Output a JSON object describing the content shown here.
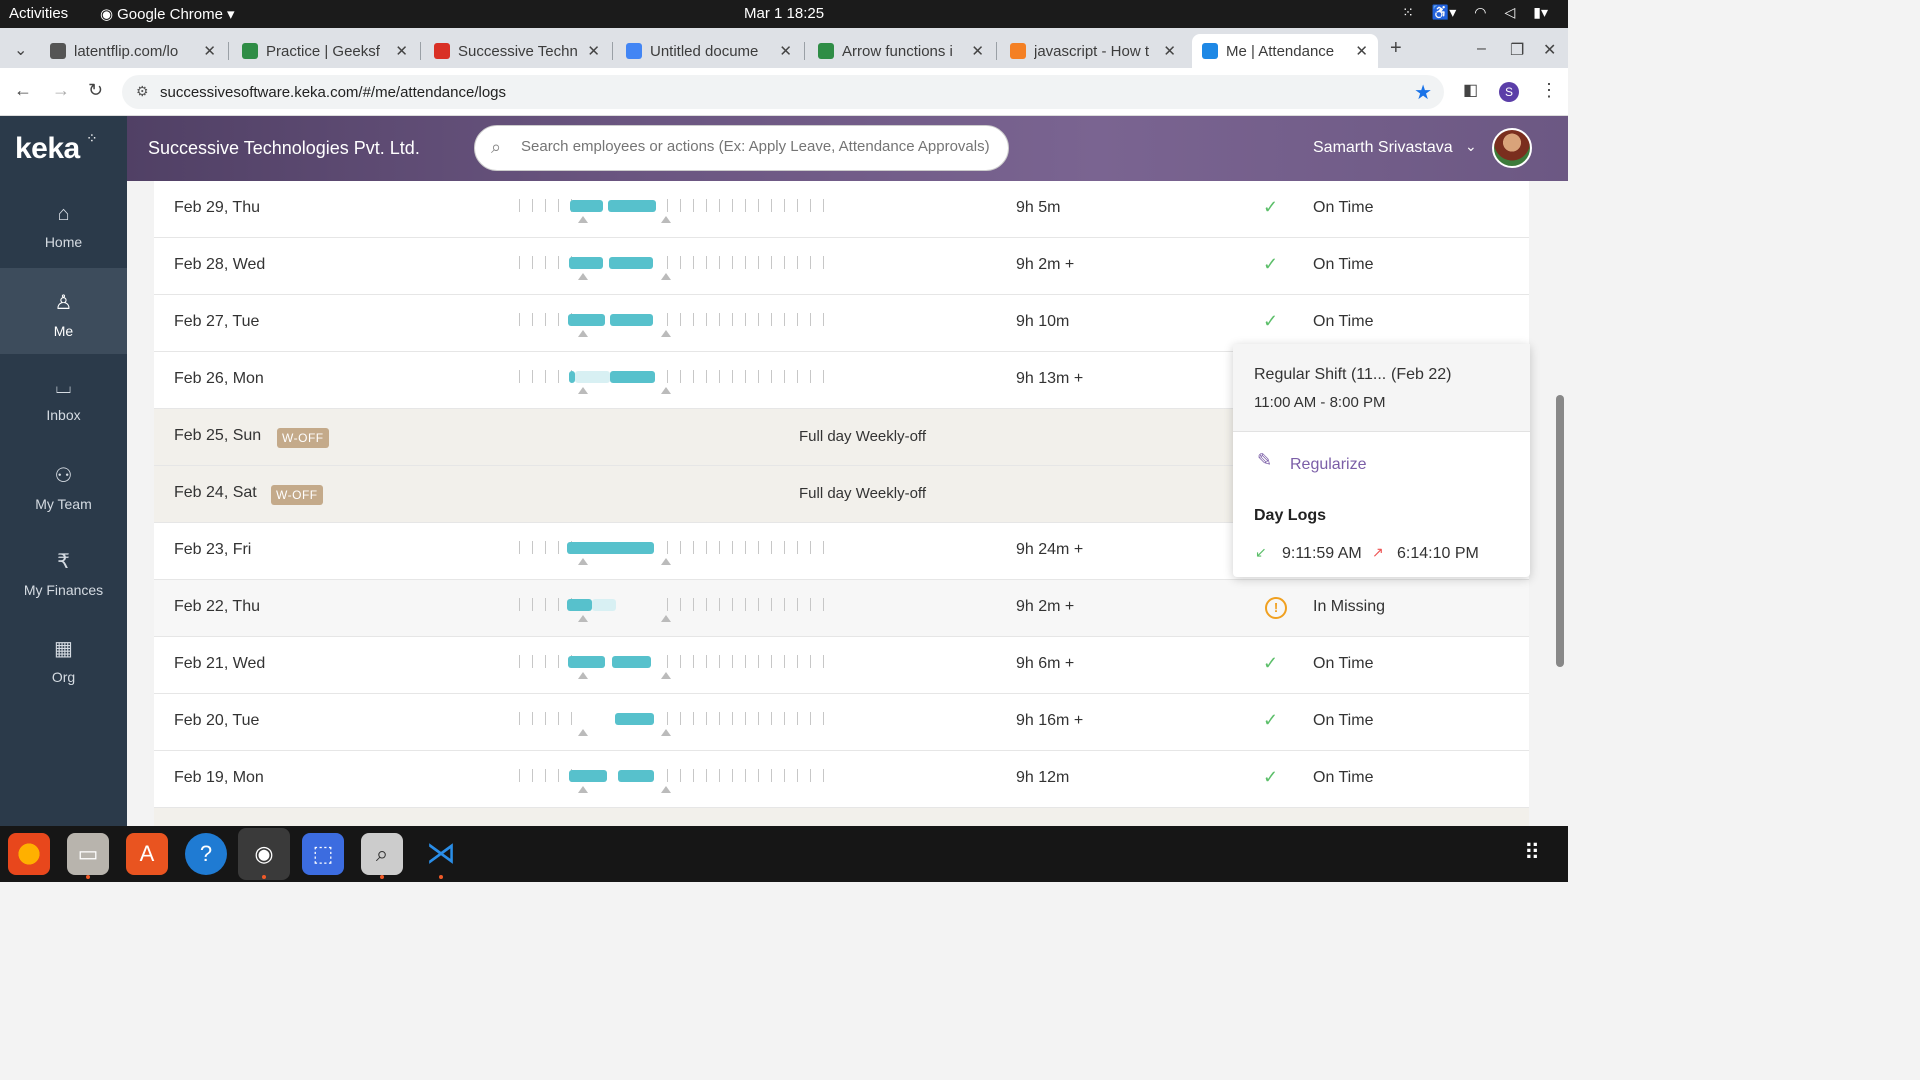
{
  "system": {
    "activities": "Activities",
    "app_name": "Google Chrome",
    "clock": "Mar 1  18:25"
  },
  "tabs": [
    {
      "title": "latentflip.com/lo",
      "favicon_color": "#555555"
    },
    {
      "title": "Practice | Geeksf",
      "favicon_color": "#2f8d46"
    },
    {
      "title": "Successive Techn",
      "favicon_color": "#d93025"
    },
    {
      "title": "Untitled docume",
      "favicon_color": "#4285f4"
    },
    {
      "title": "Arrow functions i",
      "favicon_color": "#2f8d46"
    },
    {
      "title": "javascript - How t",
      "favicon_color": "#f48024"
    },
    {
      "title": "Me | Attendance",
      "favicon_color": "#1e88e5",
      "active": true
    }
  ],
  "address": {
    "url": "successivesoftware.keka.com/#/me/attendance/logs",
    "profile_initial": "S"
  },
  "header": {
    "logo": "keka",
    "company": "Successive Technologies Pvt. Ltd.",
    "search_placeholder": "Search employees or actions (Ex: Apply Leave, Attendance Approvals)",
    "user_name": "Samarth Srivastava"
  },
  "sidebar": {
    "items": [
      {
        "label": "Home",
        "icon": "home-icon"
      },
      {
        "label": "Me",
        "icon": "person-icon",
        "active": true
      },
      {
        "label": "Inbox",
        "icon": "inbox-icon"
      },
      {
        "label": "My Team",
        "icon": "team-icon"
      },
      {
        "label": "My Finances",
        "icon": "rupee-icon"
      },
      {
        "label": "Org",
        "icon": "org-icon"
      }
    ]
  },
  "logs": [
    {
      "date": "Feb 29, Thu",
      "hours": "9h 5m",
      "status": "On Time",
      "type": "normal"
    },
    {
      "date": "Feb 28, Wed",
      "hours": "9h 2m +",
      "status": "On Time",
      "type": "normal"
    },
    {
      "date": "Feb 27, Tue",
      "hours": "9h 10m",
      "status": "On Time",
      "type": "normal"
    },
    {
      "date": "Feb 26, Mon",
      "hours": "9h 13m +",
      "status": "",
      "type": "normal"
    },
    {
      "date": "Feb 25, Sun",
      "badge": "W-OFF",
      "note": "Full day Weekly-off",
      "type": "weekoff"
    },
    {
      "date": "Feb 24, Sat",
      "badge": "W-OFF",
      "note": "Full day Weekly-off",
      "type": "weekoff"
    },
    {
      "date": "Feb 23, Fri",
      "hours": "9h 24m +",
      "status": "",
      "type": "normal"
    },
    {
      "date": "Feb 22, Thu",
      "hours": "9h 2m +",
      "status": "In Missing",
      "type": "missing"
    },
    {
      "date": "Feb 21, Wed",
      "hours": "9h 6m +",
      "status": "On Time",
      "type": "normal"
    },
    {
      "date": "Feb 20, Tue",
      "hours": "9h 16m +",
      "status": "On Time",
      "type": "normal"
    },
    {
      "date": "Feb 19, Mon",
      "hours": "9h 12m",
      "status": "On Time",
      "type": "normal"
    }
  ],
  "popover": {
    "shift_name": "Regular Shift (11...",
    "shift_date": "(Feb 22)",
    "shift_time": "11:00 AM - 8:00 PM",
    "regularize": "Regularize",
    "day_logs_title": "Day Logs",
    "in_time": "9:11:59 AM",
    "out_time": "6:14:10 PM"
  },
  "colors": {
    "sidebar_bg": "#2b3a4a",
    "bar": "#57c1cc",
    "ok": "#5cbf6a",
    "warn": "#f0a020",
    "accent": "#7b5ea7"
  }
}
